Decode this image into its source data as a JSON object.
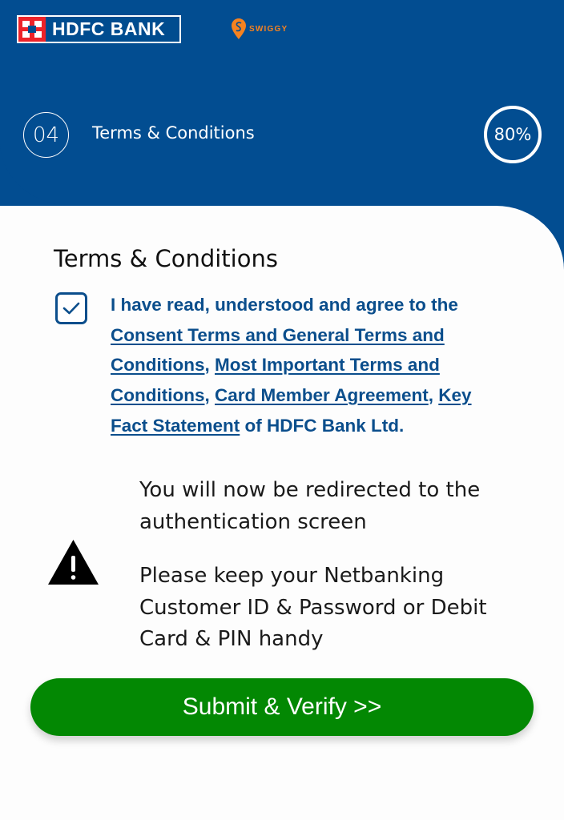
{
  "header": {
    "bank_logo_text": "HDFC BANK",
    "partner_logo_text": "SWIGGY",
    "step_number": "04",
    "step_title": "Terms & Conditions",
    "progress_percent": 80,
    "progress_label": "80%"
  },
  "colors": {
    "primary_blue": "#024d91",
    "link_blue": "#0b4e8c",
    "submit_green": "#038803",
    "hdfc_red": "#ed232a",
    "swiggy_orange": "#f58220"
  },
  "terms": {
    "title": "Terms & Conditions",
    "checkbox_checked": true,
    "intro": "I have read, understood and agree to the ",
    "links": [
      "Consent Terms and General Terms and Conditions",
      "Most Important Terms and Conditions",
      "Card Member Agreement",
      "Key Fact Statement"
    ],
    "separator": ", ",
    "outro": " of HDFC Bank Ltd."
  },
  "notice": {
    "redirect_message": "You will now be redirected to the authentication screen",
    "keep_handy_message": "Please keep your Netbanking Customer ID & Password or Debit Card & PIN handy"
  },
  "actions": {
    "submit_label": "Submit & Verify >>"
  }
}
